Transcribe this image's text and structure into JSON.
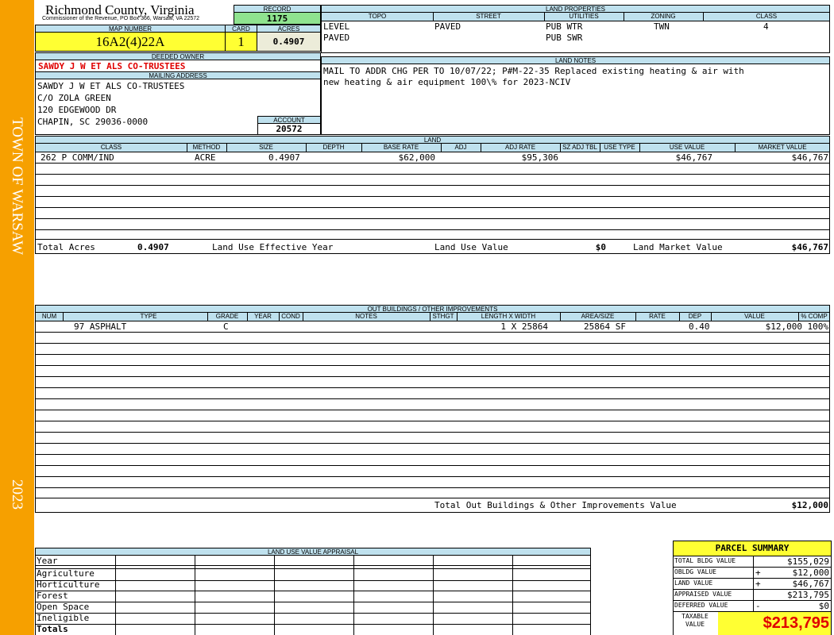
{
  "sidebar": {
    "town": "TOWN OF WARSAW",
    "year": "2023"
  },
  "header": {
    "county": "Richmond County, Virginia",
    "commissioner": "Commissioner of the Revenue, PO Box 366, Warsaw, VA 22572",
    "record_label": "RECORD",
    "record_value": "1175",
    "map_number_label": "MAP NUMBER",
    "map_number": "16A2(4)22A",
    "card_label": "CARD",
    "card_value": "1",
    "acres_label": "ACRES",
    "acres_value": "0.4907"
  },
  "owner": {
    "deeded_label": "DEEDED OWNER",
    "deeded_owner": "SAWDY J W ET ALS CO-TRUSTEES",
    "mailing_label": "MAILING ADDRESS",
    "address": [
      "SAWDY J W ET ALS CO-TRUSTEES",
      "C/O ZOLA GREEN",
      "120 EDGEWOOD DR",
      "CHAPIN, SC 29036-0000"
    ],
    "account_label": "ACCOUNT",
    "account_value": "20572"
  },
  "land_properties": {
    "title": "LAND PROPERTIES",
    "headers": [
      "TOPO",
      "STREET",
      "UTILITIES",
      "ZONING",
      "CLASS"
    ],
    "rows": [
      [
        "LEVEL",
        "PAVED",
        "PUB WTR",
        "TWN",
        "4"
      ],
      [
        "PAVED",
        "",
        "PUB SWR",
        "",
        ""
      ]
    ]
  },
  "land_notes": {
    "title": "LAND NOTES",
    "lines": [
      "MAIL TO ADDR CHG PER TO 10/07/22; P#M-22-35 Replaced existing heating & air with",
      "new heating & air equipment 100\\% for 2023-NCIV"
    ]
  },
  "land": {
    "title": "LAND",
    "headers": [
      "CLASS",
      "METHOD",
      "SIZE",
      "DEPTH",
      "BASE RATE",
      "ADJ",
      "ADJ RATE",
      "SZ ADJ TBL",
      "USE TYPE",
      "USE VALUE",
      "MARKET VALUE"
    ],
    "row": [
      "262 P COMM/IND",
      "ACRE",
      "0.4907",
      "",
      "$62,000",
      "",
      "$95,306",
      "",
      "",
      "$46,767",
      "$46,767"
    ],
    "total_acres_label": "Total Acres",
    "total_acres": "0.4907",
    "effective_year_label": "Land Use Effective Year",
    "use_value_label": "Land Use Value",
    "use_value": "$0",
    "market_value_label": "Land Market Value",
    "market_value": "$46,767"
  },
  "outbuildings": {
    "title": "OUT BUILDINGS / OTHER IMPROVEMENTS",
    "headers": [
      "NUM",
      "TYPE",
      "GRADE",
      "YEAR",
      "COND",
      "NOTES",
      "STHGT",
      "LENGTH X WIDTH",
      "AREA/SIZE",
      "RATE",
      "DEP",
      "VALUE",
      "% COMP"
    ],
    "row": [
      "",
      "97 ASPHALT",
      "C",
      "",
      "",
      "",
      "",
      "1 X 25864",
      "25864 SF",
      "",
      "0.40",
      "$12,000",
      "100%"
    ],
    "total_label": "Total Out Buildings & Other Improvements Value",
    "total_value": "$12,000"
  },
  "land_use_appraisal": {
    "title": "LAND USE VALUE APPRAISAL",
    "rows": [
      "Year",
      "Agriculture",
      "Horticulture",
      "Forest",
      "Open Space",
      "Ineligible",
      "Totals"
    ]
  },
  "parcel_summary": {
    "title": "PARCEL SUMMARY",
    "rows": [
      {
        "label": "TOTAL BLDG VALUE",
        "sign": "",
        "value": "$155,029"
      },
      {
        "label": "OBLDG VALUE",
        "sign": "+",
        "value": "$12,000"
      },
      {
        "label": "LAND VALUE",
        "sign": "+",
        "value": "$46,767"
      },
      {
        "label": "APPRAISED VALUE",
        "sign": "",
        "value": "$213,795"
      },
      {
        "label": "DEFERRED VALUE",
        "sign": "-",
        "value": "$0"
      }
    ],
    "taxable_label": "TAXABLE VALUE",
    "taxable_value": "$213,795"
  },
  "colors": {
    "sidebar": "#f6a000",
    "header_band": "#bfe1ee",
    "highlight_yellow": "#ffff33",
    "record_green": "#8fe38f",
    "acres_bg": "#ececd9",
    "red_text": "#e00000"
  }
}
